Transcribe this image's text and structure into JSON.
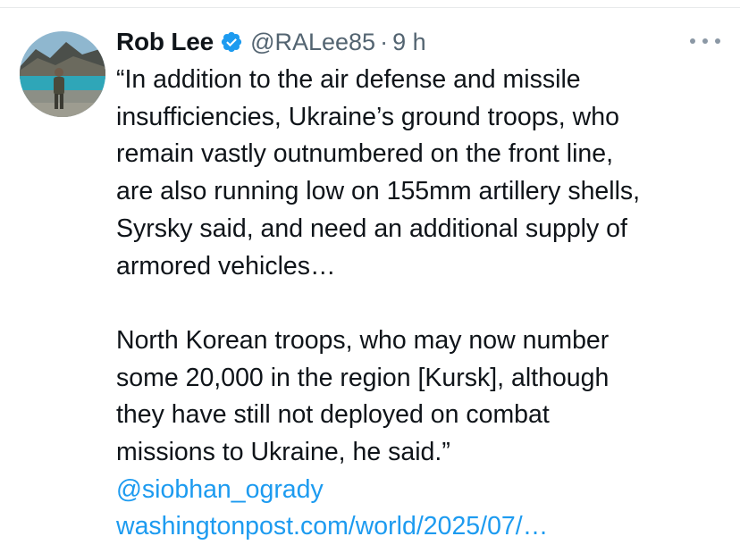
{
  "tweet": {
    "author_name": "Rob Lee",
    "handle": "@RALee85",
    "separator": "·",
    "time": "9 h",
    "text_lines": [
      "“In addition to the air defense and missile",
      "insufficiencies, Ukraine’s ground troops, who",
      "remain vastly outnumbered on the front line,",
      "are also running low on 155mm artillery shells,",
      "Syrsky said, and need an additional supply of",
      "armored vehicles…",
      "North Korean troops, who may now number",
      "some 20,000 in the region [Kursk], although",
      "they have still not deployed on combat",
      "missions to Ukraine, he said.”"
    ],
    "mention": "@siobhan_ogrady",
    "link": "washingtonpost.com/world/2025/07/…"
  },
  "icons": {
    "verified": "verified-badge-icon",
    "more": "more-options-icon"
  },
  "colors": {
    "text": "#0f1419",
    "secondary": "#536471",
    "link": "#1d9bf0",
    "verified": "#1d9bf0"
  }
}
